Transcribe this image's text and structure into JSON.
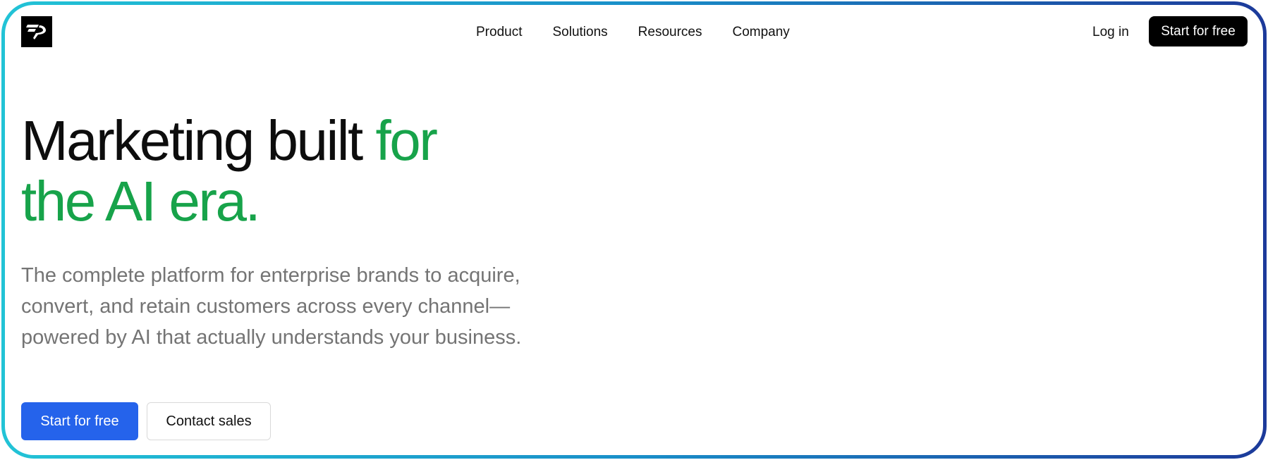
{
  "header": {
    "logo_icon": "brand-logo-icon",
    "nav": [
      {
        "label": "Product"
      },
      {
        "label": "Solutions"
      },
      {
        "label": "Resources"
      },
      {
        "label": "Company"
      }
    ],
    "login_label": "Log in",
    "cta_label": "Start for free"
  },
  "hero": {
    "headline_part1": "Marketing built",
    "headline_part2": "for",
    "headline_part3": "the AI era.",
    "subtitle_lines": [
      "The complete platform for enterprise brands to acquire,",
      "convert, and retain customers across every channel—",
      "powered by AI that actually understands your business."
    ],
    "primary_button": "Start for free",
    "secondary_button": "Contact sales"
  },
  "colors": {
    "accent_green": "#17a34a",
    "primary_blue": "#2563eb",
    "frame_gradient_start": "#22c3d6",
    "frame_gradient_end": "#1c3a9a"
  }
}
